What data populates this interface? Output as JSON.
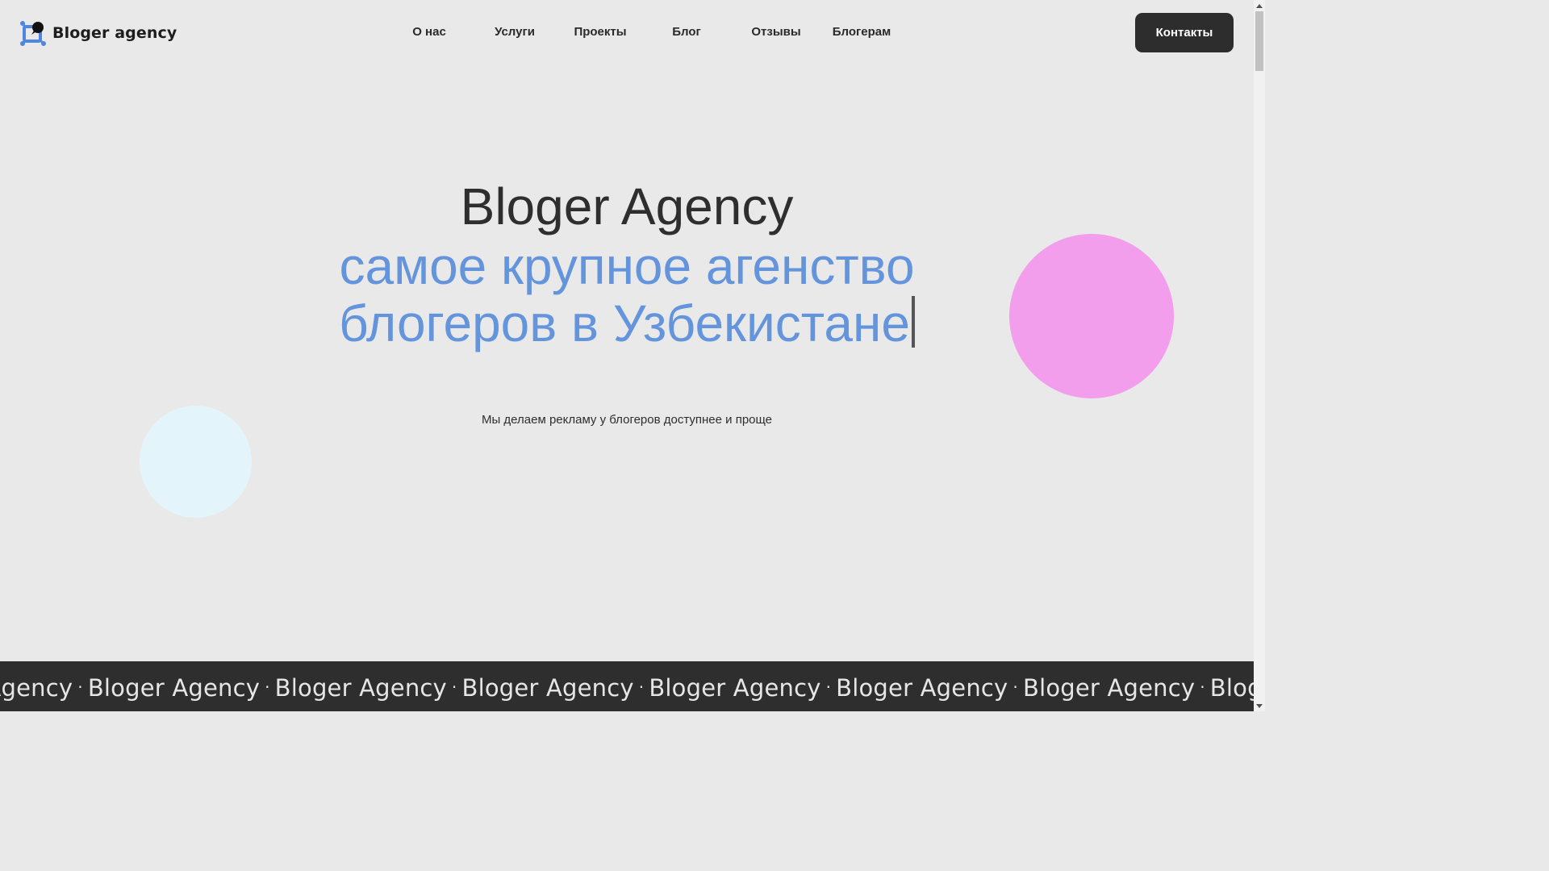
{
  "header": {
    "brand": "Bloger agency",
    "logo_icon": "agency-logo-icon",
    "nav": [
      {
        "label": "О нас"
      },
      {
        "label": "Услуги"
      },
      {
        "label": "Проекты"
      },
      {
        "label": "Блог"
      },
      {
        "label": "Отзывы"
      },
      {
        "label": "Блогерам"
      }
    ],
    "contact_label": "Контакты"
  },
  "hero": {
    "title": "Bloger Agency",
    "subtitle_line1": "самое крупное агенство",
    "subtitle_line2": "блогеров в Узбекистане",
    "tagline": "Мы делаем рекламу у блогеров доступнее и проще"
  },
  "marquee": {
    "text": "Bloger Agency",
    "separator": "·"
  },
  "colors": {
    "background": "#e9e9e9",
    "accent_blue": "#6495dc",
    "dark": "#2e2e2e",
    "circle_pink": "#f29eed",
    "circle_light_blue": "#e3f5fb"
  }
}
